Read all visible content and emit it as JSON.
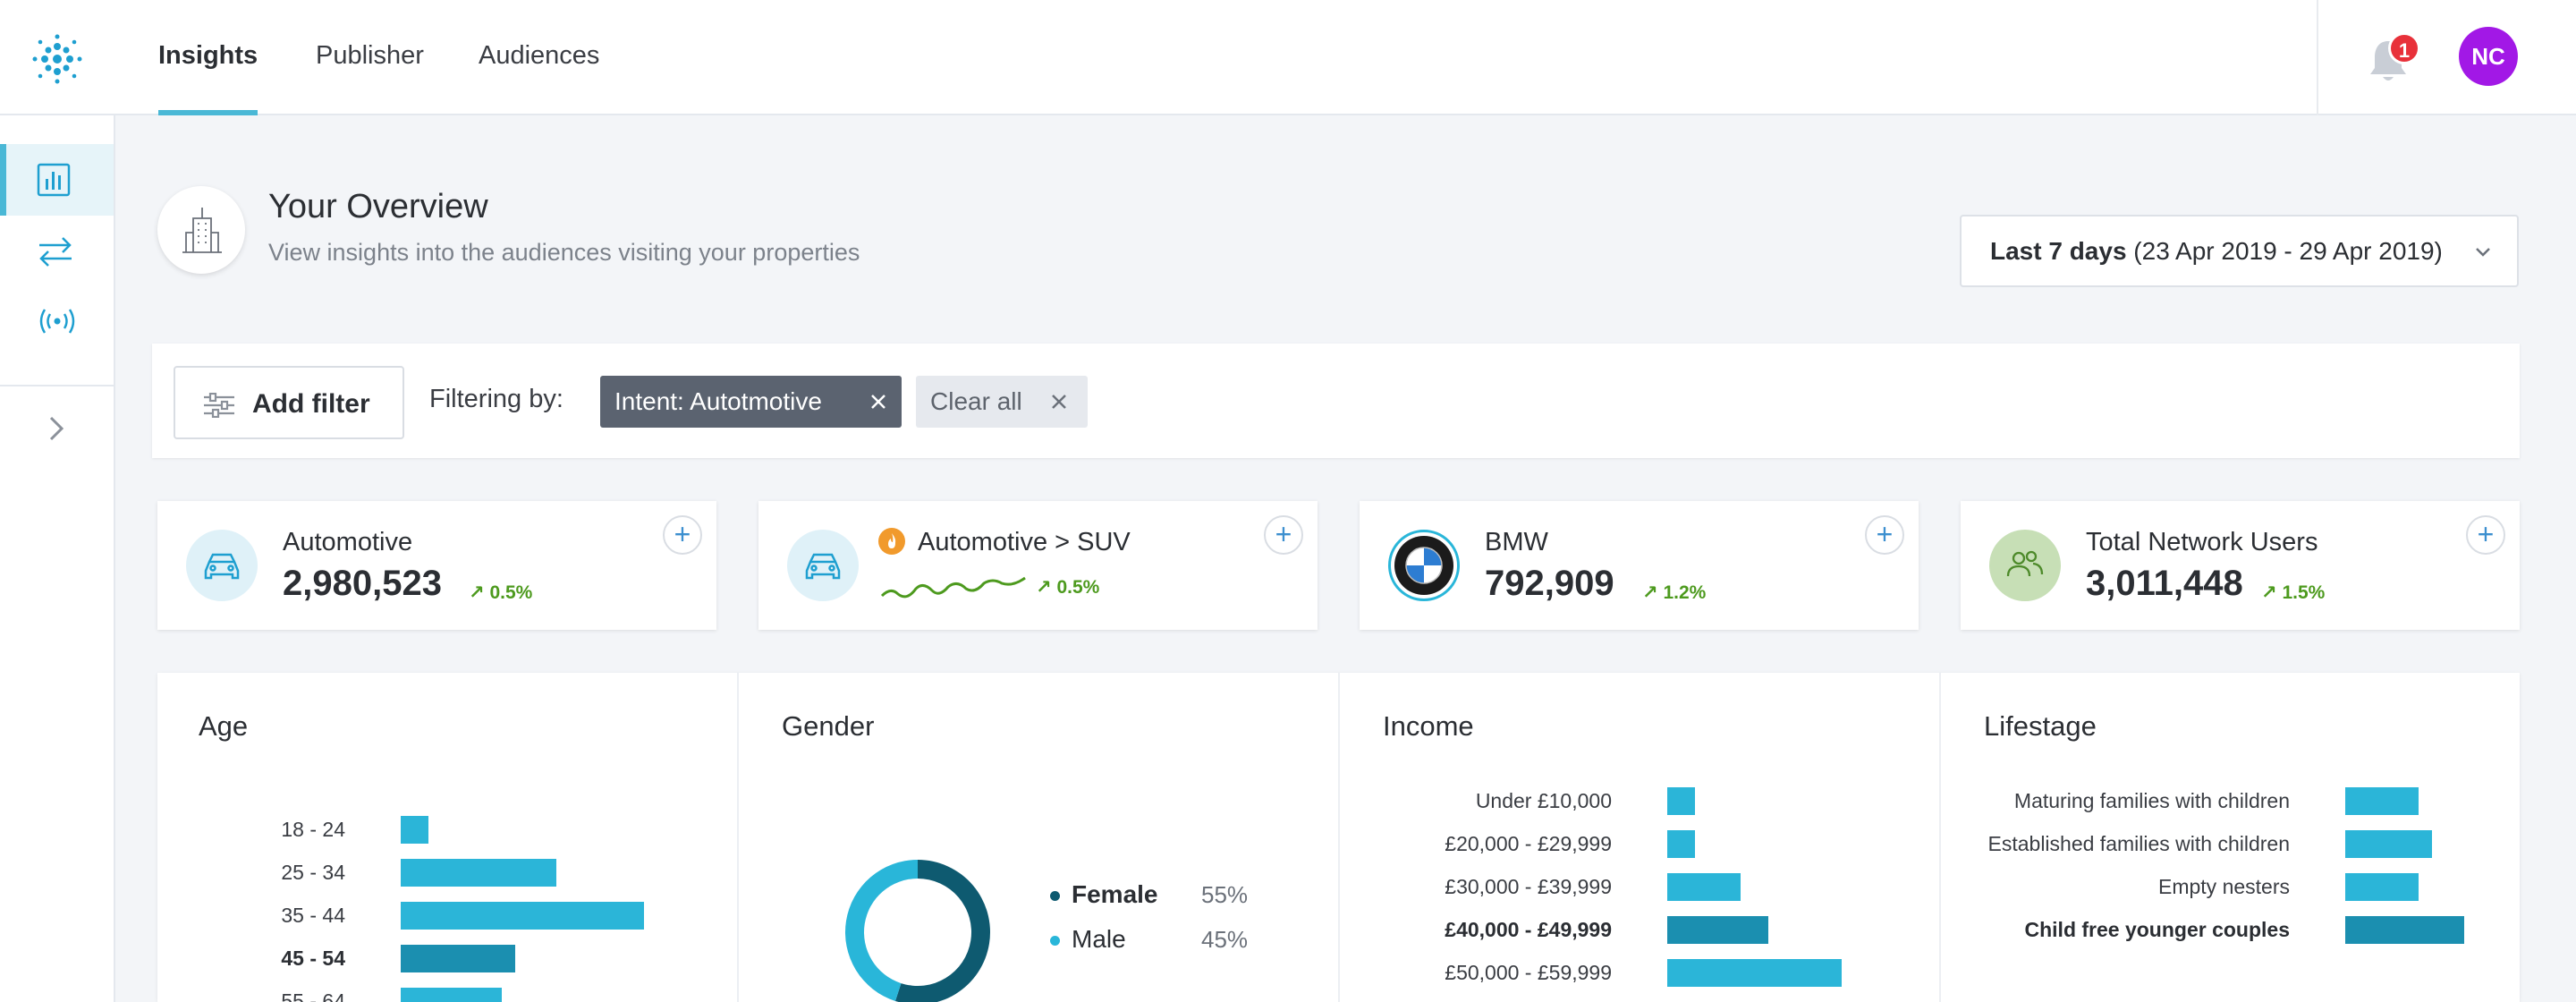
{
  "nav": {
    "tabs": [
      {
        "label": "Insights",
        "active": true
      },
      {
        "label": "Publisher",
        "active": false
      },
      {
        "label": "Audiences",
        "active": false
      }
    ],
    "notifications": "1",
    "avatar_initials": "NC",
    "avatar_color": "#a218e6"
  },
  "sidebar": {
    "items": [
      {
        "icon": "bar-chart-icon",
        "active": true
      },
      {
        "icon": "swap-arrows-icon",
        "active": false
      },
      {
        "icon": "broadcast-icon",
        "active": false
      }
    ],
    "expand_icon": "chevron-right-icon"
  },
  "overview": {
    "title": "Your Overview",
    "subtitle": "View insights into the audiences visiting your properties",
    "date_range_bold": "Last 7 days",
    "date_range_rest": " (23 Apr 2019 - 29 Apr 2019)"
  },
  "filters": {
    "add_filter_label": "Add filter",
    "filtering_by_label": "Filtering by:",
    "active_filter": "Intent: Autotmotive",
    "clear_all_label": "Clear all"
  },
  "stats": [
    {
      "label": "Automotive",
      "value": "2,980,523",
      "trend": "0.5%",
      "icon": "car-icon"
    },
    {
      "label": "Automotive > SUV",
      "value": "",
      "trend": "0.5%",
      "icon": "car-icon",
      "badge": "fire-icon"
    },
    {
      "label": "BMW",
      "value": "792,909",
      "trend": "1.2%",
      "icon": "bmw-logo-icon"
    },
    {
      "label": "Total Network Users",
      "value": "3,011,448",
      "trend": "1.5%",
      "icon": "users-icon"
    }
  ],
  "colors": {
    "accent": "#4ab8d6",
    "bar": "#2bb5d8",
    "bar_dark": "#1b8fb0",
    "female": "#0e5a70",
    "male": "#29b6d9",
    "trend_up": "#4d9a1e"
  },
  "panels": {
    "age_title": "Age",
    "gender_title": "Gender",
    "income_title": "Income",
    "lifestage_title": "Lifestage"
  },
  "chart_data": [
    {
      "type": "bar",
      "title": "Age",
      "categories": [
        "18 - 24",
        "25 - 34",
        "35 - 44",
        "45 - 54",
        "55 - 64"
      ],
      "values": [
        6,
        34,
        53,
        25,
        22
      ],
      "highlighted": "45 - 54"
    },
    {
      "type": "pie",
      "title": "Gender",
      "categories": [
        "Female",
        "Male"
      ],
      "values": [
        55,
        45
      ],
      "labels": [
        "55%",
        "45%"
      ],
      "highlighted": "Female"
    },
    {
      "type": "bar",
      "title": "Income",
      "categories": [
        "Under £10,000",
        "£20,000 - £29,999",
        "£30,000 - £39,999",
        "£40,000 - £49,999",
        "£50,000 - £59,999"
      ],
      "values": [
        6,
        6,
        16,
        22,
        38
      ],
      "highlighted": "£40,000 - £49,999"
    },
    {
      "type": "bar",
      "title": "Lifestage",
      "categories": [
        "Maturing families with children",
        "Established families with children",
        "Empty nesters",
        "Child free younger couples"
      ],
      "values": [
        16,
        19,
        16,
        26
      ],
      "highlighted": "Child free younger couples"
    }
  ]
}
